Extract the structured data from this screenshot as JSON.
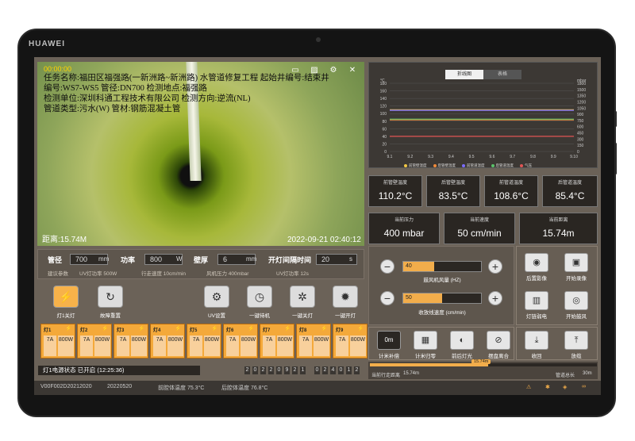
{
  "device": {
    "brand": "HUAWEI"
  },
  "video": {
    "timer": "00:00:00",
    "line1": "任务名称:福田区福强路(一新洲路~新洲路) 水管道修复工程  起始井编号:结束井",
    "line2": "编号:WS7-WS5  管径:DN700  检测地点:福强路",
    "line3": "检测单位:深圳科通工程技术有限公司  检测方向:逆流(NL)",
    "line4": "管道类型:污水(W)  管材:钢筋混凝土管",
    "distance": "距离:15.74M",
    "datetime": "2022-09-21  02:40:12",
    "icons": [
      "video-icon",
      "image-icon",
      "settings-icon",
      "close-icon"
    ]
  },
  "chart": {
    "tabs": [
      "折线图",
      "表格"
    ],
    "active_tab": "折线图",
    "left_unit": "°C",
    "right_unit": "mbar",
    "left_ticks": [
      "180",
      "160",
      "140",
      "120",
      "100",
      "80",
      "60",
      "40",
      "20",
      "0"
    ],
    "right_ticks": [
      "1800",
      "1500",
      "1350",
      "1200",
      "1050",
      "900",
      "750",
      "600",
      "450",
      "300",
      "150",
      "0"
    ],
    "x_ticks": [
      "9.1",
      "9.2",
      "9.3",
      "9.4",
      "9.5",
      "9.6",
      "9.7",
      "9.8",
      "9.9",
      "9.10"
    ],
    "legend": [
      "前管壁温度",
      "后管壁温度",
      "前管道温度",
      "后管道温度",
      "气压"
    ]
  },
  "chart_data": {
    "type": "line",
    "x": [
      "9.1",
      "9.2",
      "9.3",
      "9.4",
      "9.5",
      "9.6",
      "9.7",
      "9.8",
      "9.9",
      "9.10"
    ],
    "series": [
      {
        "name": "前管壁温度",
        "color": "#f2c744",
        "values": [
          110.2,
          110.2,
          110.2,
          110.2,
          110.2,
          110.2,
          110.2,
          110.2,
          110.2,
          110.2
        ]
      },
      {
        "name": "后管壁温度",
        "color": "#f08a3a",
        "values": [
          83.5,
          83.5,
          83.5,
          83.5,
          83.5,
          83.5,
          83.5,
          83.5,
          83.5,
          83.5
        ]
      },
      {
        "name": "前管道温度",
        "color": "#7b6cff",
        "values": [
          108.6,
          108.6,
          108.6,
          108.6,
          108.6,
          108.6,
          108.6,
          108.6,
          108.6,
          108.6
        ]
      },
      {
        "name": "后管道温度",
        "color": "#5ac26a",
        "values": [
          85.4,
          85.4,
          85.4,
          85.4,
          85.4,
          85.4,
          85.4,
          85.4,
          85.4,
          85.4
        ]
      },
      {
        "name": "气压",
        "color": "#e25555",
        "axis": "right",
        "values": [
          400,
          400,
          400,
          400,
          400,
          400,
          400,
          400,
          400,
          400
        ]
      }
    ],
    "ylim": [
      0,
      180
    ],
    "y2lim": [
      0,
      1800
    ],
    "legend_position": "bottom"
  },
  "cards": {
    "front_wall_label": "前管壁温度",
    "front_wall_value": "110.2°C",
    "rear_wall_label": "后管壁温度",
    "rear_wall_value": "83.5°C",
    "front_pipe_label": "前管道温度",
    "front_pipe_value": "108.6°C",
    "rear_pipe_label": "后管道温度",
    "rear_pipe_value": "85.4°C",
    "pressure_label": "当前压力",
    "pressure_value": "400 mbar",
    "speed_label": "当前速度",
    "speed_value": "50 cm/min",
    "distance_label": "当前距离",
    "distance_value": "15.74m"
  },
  "params": {
    "pipe_label": "管径",
    "pipe_value": "700",
    "pipe_unit": "mm",
    "power_label": "功率",
    "power_value": "800",
    "power_unit": "W",
    "wall_label": "壁厚",
    "wall_value": "6",
    "wall_unit": "mm",
    "interval_label": "开灯间隔时间",
    "interval_value": "20",
    "interval_unit": "s",
    "suggest": "建议参数",
    "uv_power": "UV灯功率  500W",
    "walk_speed": "行走速度  10cm/min",
    "fan_pressure": "风机压力  400mbar",
    "uv_power2": "UV灯功率  12s"
  },
  "actions": {
    "lamp_off": "灯1关灯",
    "fault_reset": "故障重置",
    "uv_settings": "UV设置",
    "standby": "一键待机",
    "all_off": "一键关灯",
    "all_on": "一键开灯"
  },
  "lamps": [
    {
      "name": "灯1",
      "current": "7A",
      "power": "800W"
    },
    {
      "name": "灯2",
      "current": "7A",
      "power": "800W"
    },
    {
      "name": "灯3",
      "current": "7A",
      "power": "800W"
    },
    {
      "name": "灯4",
      "current": "7A",
      "power": "800W"
    },
    {
      "name": "灯5",
      "current": "7A",
      "power": "800W"
    },
    {
      "name": "灯6",
      "current": "7A",
      "power": "800W"
    },
    {
      "name": "灯7",
      "current": "7A",
      "power": "800W"
    },
    {
      "name": "灯8",
      "current": "7A",
      "power": "800W"
    },
    {
      "name": "灯9",
      "current": "7A",
      "power": "800W"
    }
  ],
  "status": {
    "lamp_power": "灯1电源状态   已开启  (12:25:36)",
    "date_digits": [
      "2",
      "0",
      "2",
      "2",
      "0",
      "9",
      "2",
      "1"
    ],
    "time_digits": [
      "0",
      "2",
      "4",
      "0",
      "1",
      "2"
    ]
  },
  "bottom": {
    "version": "V00F002D20212020",
    "date": "20220520",
    "front_temp": "前腔体温度    75.3°C",
    "rear_temp": "后腔体温度    76.8°C"
  },
  "controls": {
    "fan_value": "40",
    "fan_fraction": 0.4,
    "fan_label": "鼓风机风量 (HZ)",
    "winch_value": "50",
    "winch_fraction": 0.5,
    "winch_label": "收放线速度 (cm/min)",
    "rear_image": "后置影像",
    "start_record": "开始录像",
    "lamp_chain": "灯链弱电",
    "start_blow": "开始鼓风",
    "meter_display": "0m",
    "meter_compensate": "计米补偿",
    "meter_zero": "计米归零",
    "front_rear_light": "前后灯光",
    "clutch": "摆盘离合",
    "retract": "收回",
    "release": "放缆"
  },
  "progress": {
    "marker": "15.74m",
    "fraction": 0.52,
    "current_label": "当前行走距离",
    "current_value": "15.74m",
    "total_label": "管道总长",
    "total_value": "30m"
  }
}
